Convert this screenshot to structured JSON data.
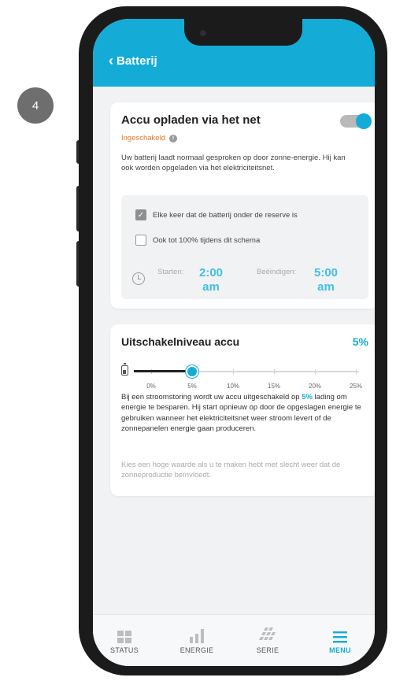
{
  "step_number": "4",
  "header": {
    "back_label": "Batterij"
  },
  "charge_card": {
    "title": "Accu opladen via het net",
    "status": "Ingeschakeld",
    "toggle_on": true,
    "description": "Uw batterij laadt normaal gesproken op door zonne-energie. Hij kan ook worden opgeladen via het elektriciteitsnet.",
    "options": [
      {
        "label": "Elke keer dat de batterij onder de reserve is",
        "checked": true
      },
      {
        "label": "Ook tot 100% tijdens dit schema",
        "checked": false
      }
    ],
    "schedule": {
      "start_label": "Starten:",
      "start_value": "2:00 am",
      "end_label": "Beëindigen:",
      "end_value": "5:00 am"
    }
  },
  "shutdown_card": {
    "title": "Uitschakelniveau accu",
    "value": "5%",
    "level_percent": 5,
    "slider_max": 25,
    "ticks": [
      "0%",
      "5%",
      "10%",
      "15%",
      "20%",
      "25%"
    ],
    "description_pre": "Bij een stroomstoring wordt uw accu uitgeschakeld op ",
    "description_value": "5%",
    "description_post": " lading om energie te besparen. Hij start opnieuw op door de opgeslagen energie te gebruiken wanneer het elektriciteitsnet weer stroom levert of de zonnepanelen energie gaan produceren.",
    "hint": "Kies een hoge waarde als u te maken hebt met slecht weer dat de zonneproductie beïnvloedt."
  },
  "tabs": [
    {
      "label": "STATUS",
      "icon": "status-grid-icon"
    },
    {
      "label": "ENERGIE",
      "icon": "energy-bars-icon"
    },
    {
      "label": "SERIE",
      "icon": "solar-panel-icon"
    },
    {
      "label": "MENU",
      "icon": "menu-icon",
      "active": true
    }
  ],
  "colors": {
    "accent": "#14acd6",
    "status": "#e07a2a"
  }
}
